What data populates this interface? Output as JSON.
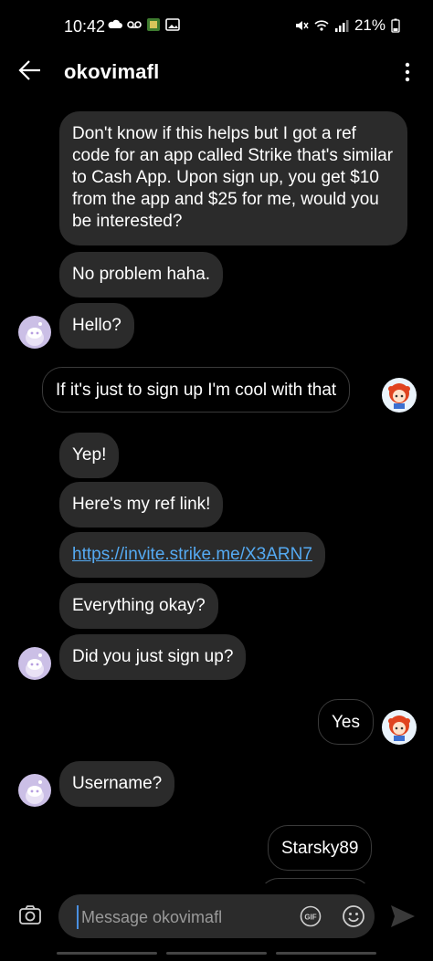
{
  "status_bar": {
    "time": "10:42",
    "battery": "21%",
    "icons_left": [
      "cloud-icon",
      "voicemail-icon",
      "game-icon",
      "gallery-icon"
    ],
    "icons_right": [
      "mute-icon",
      "wifi-icon",
      "signal-icon"
    ]
  },
  "header": {
    "title": "okovimafl",
    "back_icon": "arrow-left-icon",
    "menu_icon": "more-vertical-icon"
  },
  "messages": [
    {
      "direction": "in",
      "text": "Don't know if this helps but I got a ref code for an app called Strike that's similar to Cash App. Upon sign up, you get $10 from the app and $25 for me, would you be interested?"
    },
    {
      "direction": "in",
      "text": "No problem haha."
    },
    {
      "direction": "in",
      "text": "Hello?"
    },
    {
      "direction": "out",
      "text": "If it's just to sign up I'm cool with that"
    },
    {
      "direction": "in",
      "text": "Yep!"
    },
    {
      "direction": "in",
      "text": "Here's my ref link!"
    },
    {
      "direction": "in",
      "text": "https://invite.strike.me/X3ARN7",
      "is_link": true
    },
    {
      "direction": "in",
      "text": "Everything okay?"
    },
    {
      "direction": "in",
      "text": "Did you just sign up?"
    },
    {
      "direction": "out",
      "text": "Yes"
    },
    {
      "direction": "in",
      "text": "Username?"
    },
    {
      "direction": "out",
      "text": "Starsky89"
    },
    {
      "direction": "out",
      "text": ""
    }
  ],
  "composer": {
    "placeholder": "Message okovimafl",
    "value": "",
    "gif_label": "GIF",
    "camera_icon": "camera-icon",
    "emoji_icon": "emoji-icon",
    "send_icon": "send-icon"
  },
  "colors": {
    "background": "#000000",
    "incoming_bubble": "#2b2b2b",
    "link": "#55aaf2",
    "incoming_avatar": "#cbbfe6"
  }
}
